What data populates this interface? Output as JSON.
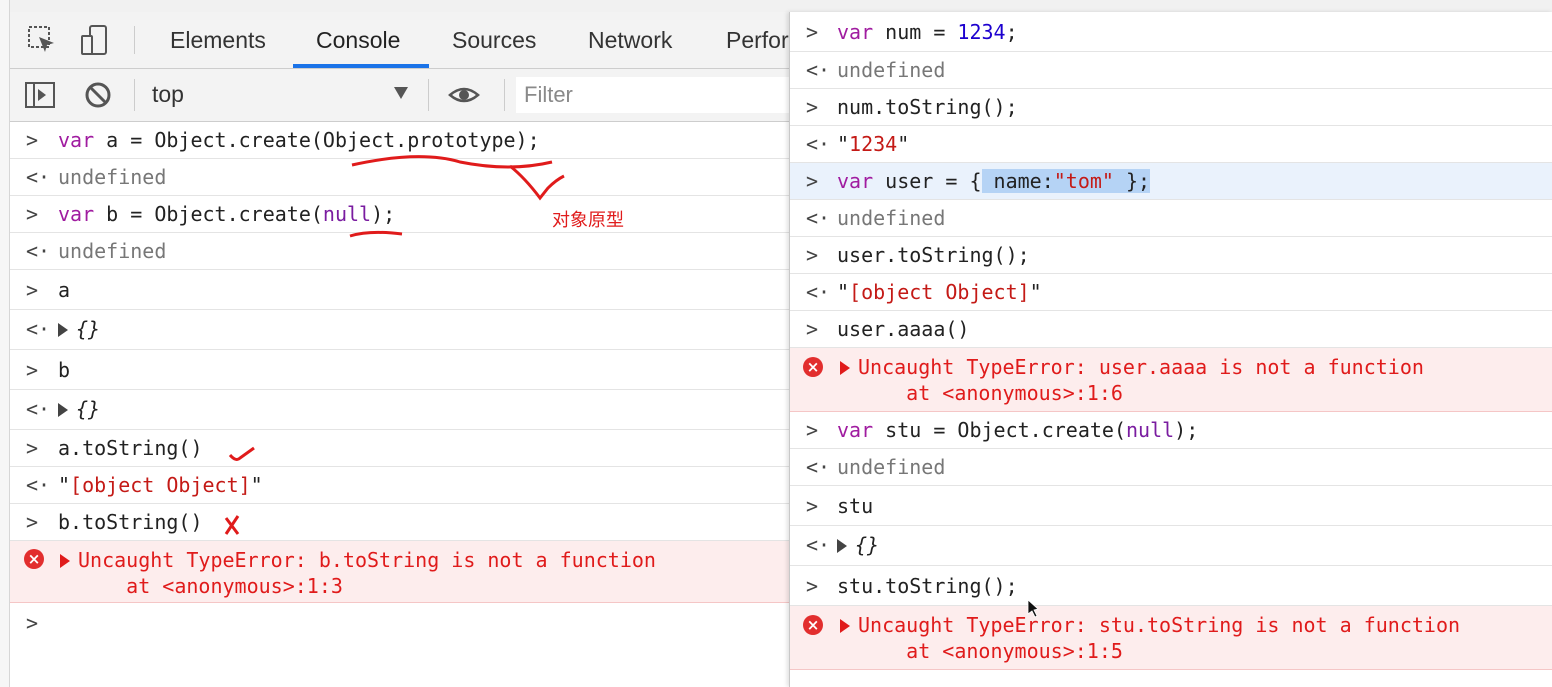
{
  "tabs": [
    {
      "label": "Elements"
    },
    {
      "label": "Console"
    },
    {
      "label": "Sources"
    },
    {
      "label": "Network"
    },
    {
      "label": "Perfor"
    }
  ],
  "toolbar": {
    "context": "top",
    "filter_placeholder": "Filter"
  },
  "left_console": {
    "r1": {
      "kw": "var",
      "mid": " a = Object.create(Object.prototype);"
    },
    "r2": "undefined",
    "r3": {
      "kw": "var",
      "mid1": " b = Object.create(",
      "nul": "null",
      "end": ");"
    },
    "r4": "undefined",
    "r5": "a",
    "r6": "{}",
    "r7": "b",
    "r8": "{}",
    "r9": "a.toString()",
    "r10": {
      "q1": "\"",
      "str": "[object Object]",
      "q2": "\""
    },
    "r11": "b.toString()",
    "err": {
      "line1": "Uncaught TypeError: b.toString is not a function",
      "line2": "    at <anonymous>:1:3"
    },
    "annotation": "对象原型"
  },
  "right_console": {
    "r1": {
      "kw": "var",
      "mid": " num = ",
      "num": "1234",
      "end": ";"
    },
    "r2": "undefined",
    "r3": "num.toString();",
    "r4": {
      "q1": "\"",
      "str": "1234",
      "q2": "\""
    },
    "r5": {
      "kw": "var",
      "mid": " user = {",
      "sel1": " name:",
      "str": "\"tom\"",
      "sel2": " ",
      "end": "};"
    },
    "r6": "undefined",
    "r7": "user.toString();",
    "r8": {
      "q1": "\"",
      "str": "[object Object]",
      "q2": "\""
    },
    "r9": "user.aaaa()",
    "err1": {
      "line1": "Uncaught TypeError: user.aaaa is not a function",
      "line2": "    at <anonymous>:1:6"
    },
    "r10": {
      "kw": "var",
      "mid": " stu = Object.create(",
      "nul": "null",
      "end": ");"
    },
    "r11": "undefined",
    "r12": "stu",
    "r13": "{}",
    "r14": "stu.toString();",
    "err2": {
      "line1": "Uncaught TypeError: stu.toString is not a function",
      "line2": "    at <anonymous>:1:5"
    }
  }
}
